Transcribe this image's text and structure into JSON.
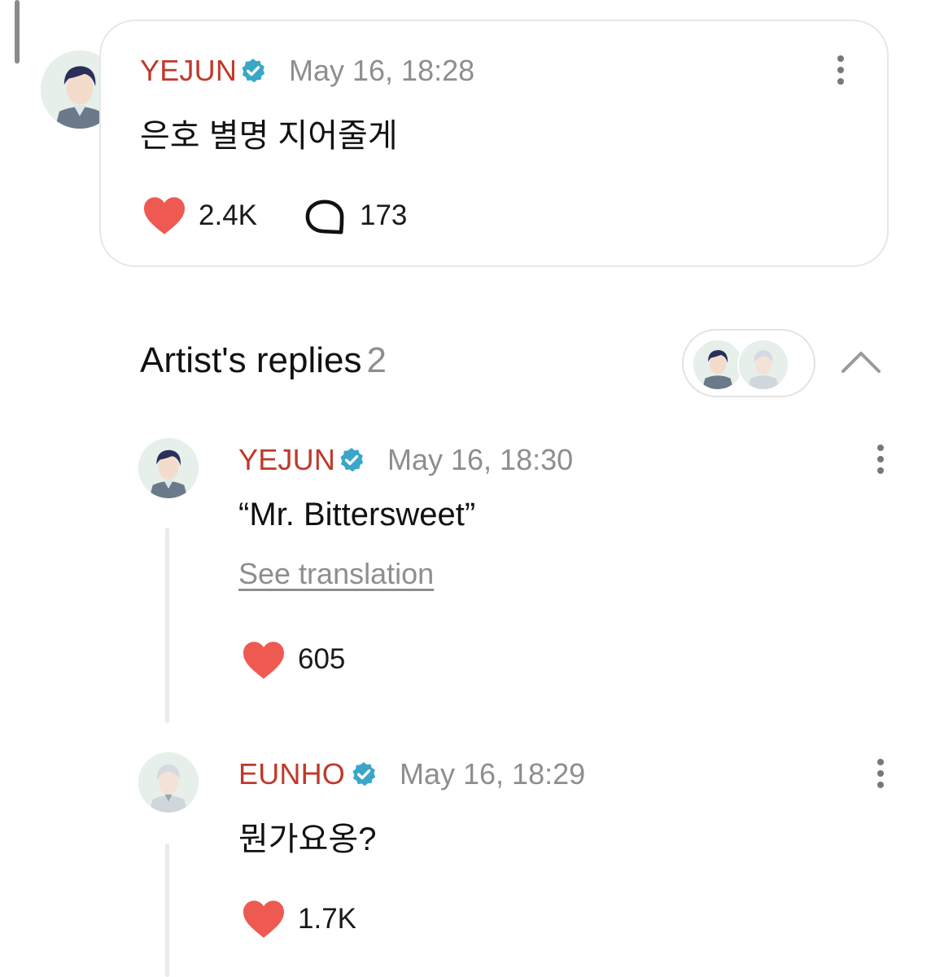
{
  "post": {
    "author": "YEJUN",
    "timestamp": "May 16, 18:28",
    "text": "은호 별명 지어줄게",
    "likes": "2.4K",
    "comments": "173"
  },
  "replies": {
    "title": "Artist's replies",
    "count": "2",
    "items": [
      {
        "author": "YEJUN",
        "timestamp": "May 16, 18:30",
        "text": "“Mr. Bittersweet”",
        "translation_link": "See translation",
        "likes": "605"
      },
      {
        "author": "EUNHO",
        "timestamp": "May 16, 18:29",
        "text": "뭔가요옹?",
        "likes": "1.7K"
      }
    ]
  },
  "colors": {
    "author_name": "#c0392b",
    "verified": "#3aa6c9",
    "heart": "#ee5a52",
    "muted": "#8e8e8e"
  },
  "icons": {
    "verified": "verified-badge-icon",
    "heart": "heart-icon",
    "comment": "comment-bubble-icon",
    "more": "more-vertical-icon",
    "collapse": "chevron-up-icon"
  }
}
